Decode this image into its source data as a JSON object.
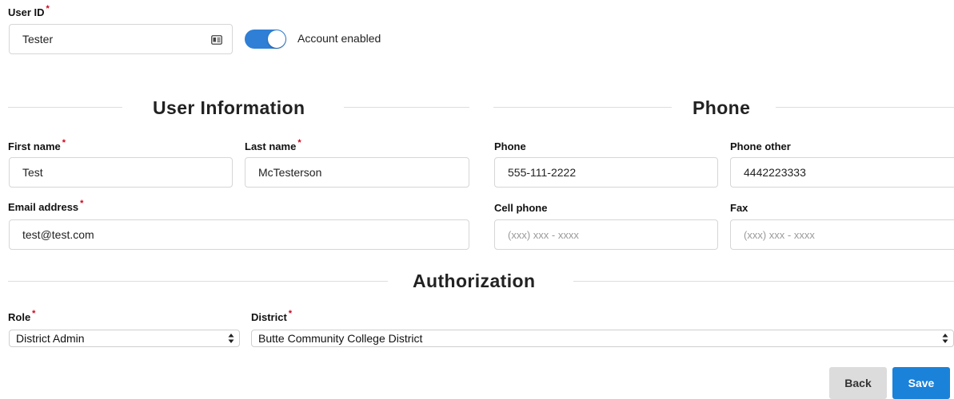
{
  "user_id": {
    "label": "User ID",
    "required": "*",
    "value": "Tester"
  },
  "account_toggle": {
    "label": "Account enabled",
    "enabled": true,
    "color": "#2f7fd6"
  },
  "sections": {
    "user_information": "User Information",
    "phone": "Phone",
    "authorization": "Authorization"
  },
  "user_info": {
    "first_name": {
      "label": "First name",
      "required": "*",
      "value": "Test"
    },
    "last_name": {
      "label": "Last name",
      "required": "*",
      "value": "McTesterson"
    },
    "email": {
      "label": "Email address",
      "required": "*",
      "value": "test@test.com"
    }
  },
  "phone_info": {
    "phone": {
      "label": "Phone",
      "value": "555-111-2222"
    },
    "phone_other": {
      "label": "Phone other",
      "value": "4442223333"
    },
    "cell_phone": {
      "label": "Cell phone",
      "placeholder": "(xxx) xxx - xxxx"
    },
    "fax": {
      "label": "Fax",
      "placeholder": "(xxx) xxx - xxxx"
    }
  },
  "authorization": {
    "role": {
      "label": "Role",
      "required": "*",
      "value": "District Admin"
    },
    "district": {
      "label": "District",
      "required": "*",
      "value": "Butte Community College District"
    }
  },
  "actions": {
    "back_label": "Back",
    "save_label": "Save"
  },
  "colors": {
    "accent": "#1a82d9",
    "required": "#d0021b"
  },
  "icons": {
    "user_id_field": "id-card-icon"
  }
}
